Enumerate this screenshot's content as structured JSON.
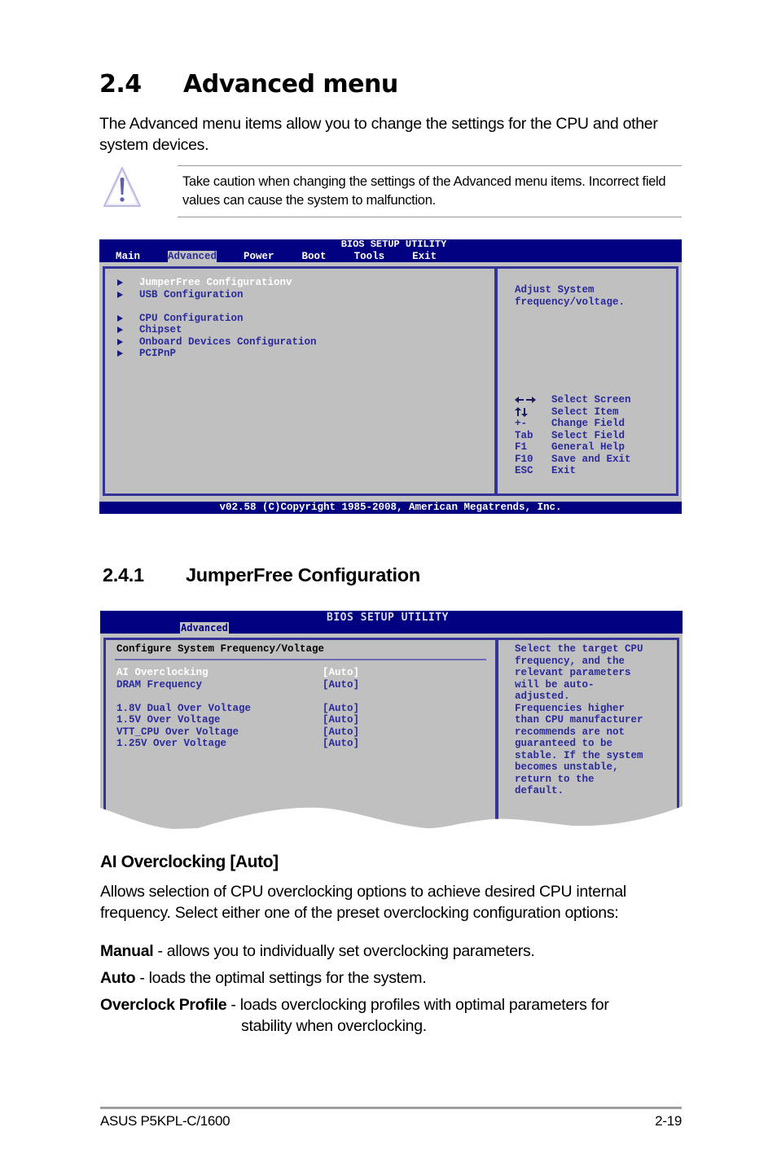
{
  "section": {
    "number": "2.4",
    "title": "Advanced menu",
    "intro": "The Advanced menu items allow you to change the settings for the CPU and other system devices."
  },
  "caution": {
    "icon": "warning-icon",
    "text": "Take caution when changing the settings of the Advanced menu items. Incorrect field values can cause the system to malfunction."
  },
  "bios_main": {
    "title": "BIOS SETUP UTILITY",
    "tabs": [
      {
        "label": "Main",
        "active": false
      },
      {
        "label": "Advanced",
        "active": true
      },
      {
        "label": "Power",
        "active": false
      },
      {
        "label": "Boot",
        "active": false
      },
      {
        "label": "Tools",
        "active": false
      },
      {
        "label": "Exit",
        "active": false
      }
    ],
    "menu_items": [
      {
        "label": "JumperFree Configurationv",
        "selected": true
      },
      {
        "label": "USB Configuration",
        "selected": false
      },
      {
        "label": "CPU Configuration",
        "selected": false
      },
      {
        "label": "Chipset",
        "selected": false
      },
      {
        "label": "Onboard Devices Configuration",
        "selected": false
      },
      {
        "label": "PCIPnP",
        "selected": false
      }
    ],
    "help_text": "Adjust System\nfrequency/voltage.",
    "keys": [
      {
        "key": "left-right-arrows-icon",
        "desc": "Select Screen"
      },
      {
        "key": "up-down-arrows-icon",
        "desc": "Select Item"
      },
      {
        "key": "+-",
        "desc": "Change Field"
      },
      {
        "key": "Tab",
        "desc": "Select Field"
      },
      {
        "key": "F1",
        "desc": "General Help"
      },
      {
        "key": "F10",
        "desc": "Save and Exit"
      },
      {
        "key": "ESC",
        "desc": "Exit"
      }
    ],
    "footer": "v02.58 (C)Copyright 1985-2008, American Megatrends, Inc."
  },
  "subsection": {
    "number": "2.4.1",
    "title": "JumperFree Configuration"
  },
  "bios_jumperfree": {
    "title": "BIOS SETUP UTILITY",
    "active_tab": "Advanced",
    "subhead": "Configure System Frequency/Voltage",
    "settings": [
      {
        "name": "AI Overclocking",
        "value": "[Auto]",
        "selected": true
      },
      {
        "name": "DRAM Frequency",
        "value": "[Auto]",
        "selected": false
      },
      {
        "name": "1.8V Dual Over Voltage",
        "value": "[Auto]",
        "selected": false
      },
      {
        "name": "1.5V Over Voltage",
        "value": "[Auto]",
        "selected": false
      },
      {
        "name": "VTT_CPU Over Voltage",
        "value": "[Auto]",
        "selected": false
      },
      {
        "name": "1.25V Over Voltage",
        "value": "[Auto]",
        "selected": false
      }
    ],
    "help_text": "Select the target CPU\nfrequency, and the\nrelevant parameters\nwill be auto-\nadjusted.\nFrequencies higher\nthan CPU manufacturer\nrecommends are not\nguaranteed to be\nstable. If the system\nbecomes unstable,\nreturn to the\ndefault."
  },
  "ai_overclocking": {
    "heading": "AI Overclocking [Auto]",
    "description": "Allows selection of CPU overclocking options to achieve desired CPU internal frequency. Select either one of the preset overclocking configuration options:",
    "options": [
      {
        "name": "Manual",
        "desc": " - allows you to individually set overclocking parameters."
      },
      {
        "name": "Auto",
        "desc": " - loads the optimal settings for the system."
      },
      {
        "name": "Overclock Profile",
        "desc": " - loads overclocking profiles with optimal parameters for",
        "desc_cont": "stability when overclocking."
      }
    ]
  },
  "page_footer": {
    "product": "ASUS P5KPL-C/1600",
    "page": "2-19"
  },
  "colors": {
    "bios_blue": "#000080",
    "bios_gray": "#c0c0c0",
    "bios_text": "#2a2a9a"
  }
}
